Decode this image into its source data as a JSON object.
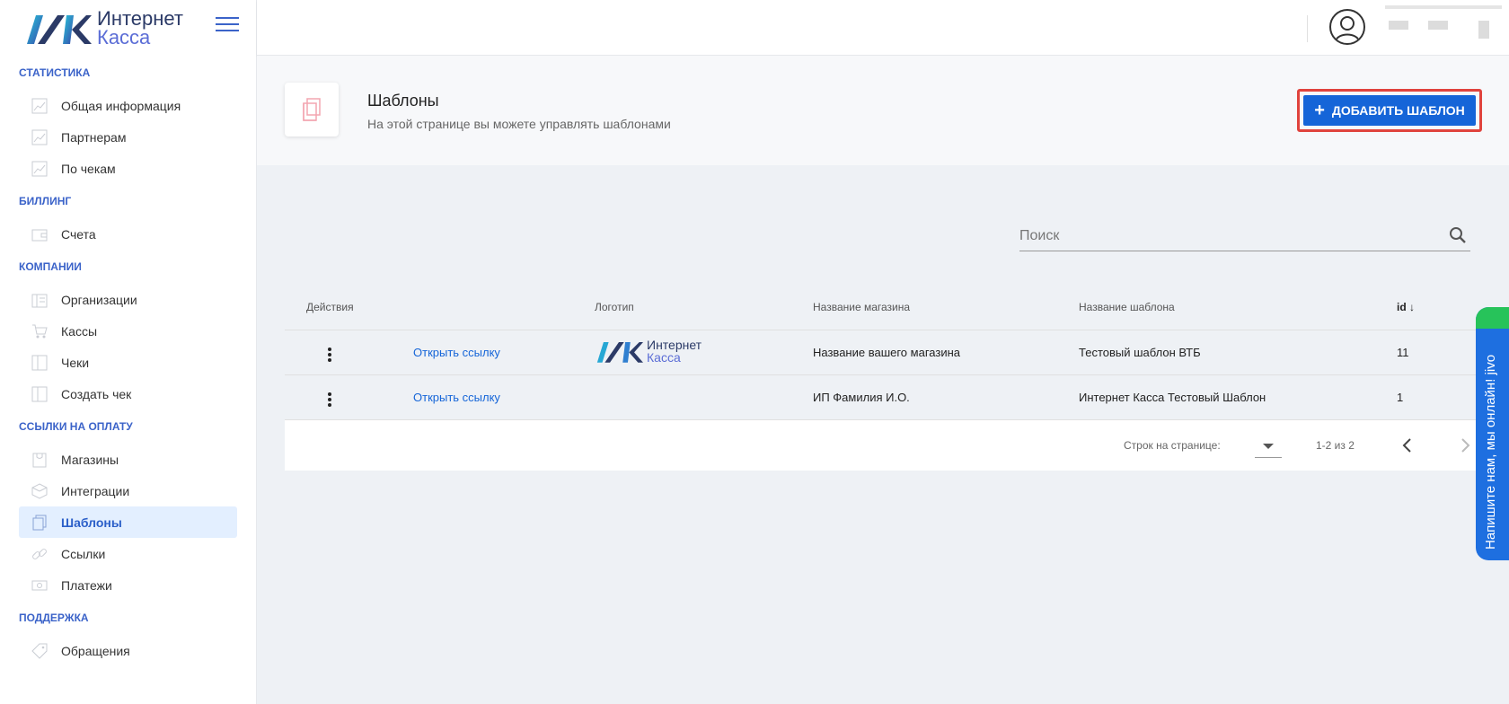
{
  "brand": {
    "line1": "Интернет",
    "line2": "Касса"
  },
  "sidebar": {
    "sections": [
      {
        "title": "СТАТИСТИКА",
        "items": [
          {
            "label": "Общая информация",
            "icon": "chart-icon"
          },
          {
            "label": "Партнерам",
            "icon": "chart-icon"
          },
          {
            "label": "По чекам",
            "icon": "chart-icon"
          }
        ]
      },
      {
        "title": "БИЛЛИНГ",
        "items": [
          {
            "label": "Счета",
            "icon": "wallet-icon"
          }
        ]
      },
      {
        "title": "КОМПАНИИ",
        "items": [
          {
            "label": "Организации",
            "icon": "building-icon"
          },
          {
            "label": "Кассы",
            "icon": "cart-icon"
          },
          {
            "label": "Чеки",
            "icon": "receipt-icon"
          },
          {
            "label": "Создать чек",
            "icon": "receipt-icon"
          }
        ]
      },
      {
        "title": "ССЫЛКИ НА ОПЛАТУ",
        "items": [
          {
            "label": "Магазины",
            "icon": "bag-icon"
          },
          {
            "label": "Интеграции",
            "icon": "integration-icon"
          },
          {
            "label": "Шаблоны",
            "icon": "copy-icon",
            "active": true
          },
          {
            "label": "Ссылки",
            "icon": "link-icon"
          },
          {
            "label": "Платежи",
            "icon": "money-icon"
          }
        ]
      },
      {
        "title": "ПОДДЕРЖКА",
        "items": [
          {
            "label": "Обращения",
            "icon": "tag-icon"
          }
        ]
      }
    ]
  },
  "page": {
    "title": "Шаблоны",
    "subtitle": "На этой странице вы можете управлять шаблонами",
    "add_button": "ДОБАВИТЬ ШАБЛОН"
  },
  "search": {
    "placeholder": "Поиск"
  },
  "table": {
    "headers": {
      "actions": "Действия",
      "logo": "Логотип",
      "shop": "Название магазина",
      "template": "Название шаблона",
      "id": "id"
    },
    "rows": [
      {
        "link": "Открыть ссылку",
        "has_logo": true,
        "shop": "Название вашего магазина",
        "template": "Тестовый шаблон ВТБ",
        "id": "11"
      },
      {
        "link": "Открыть ссылку",
        "has_logo": false,
        "shop": "ИП Фамилия И.О.",
        "template": "Интернет Касса Тестовый Шаблон",
        "id": "1"
      }
    ],
    "footer": {
      "rows_per_page_label": "Строк на странице:",
      "range": "1-2 из 2"
    }
  },
  "jivo": {
    "label": "Напишите нам, мы онлайн!",
    "brand": "jivo"
  },
  "colors": {
    "accent": "#1565d8",
    "section": "#3b63c9",
    "active_bg": "#e3efff",
    "highlight": "#e0433d",
    "jivo": "#1e6fe0"
  }
}
